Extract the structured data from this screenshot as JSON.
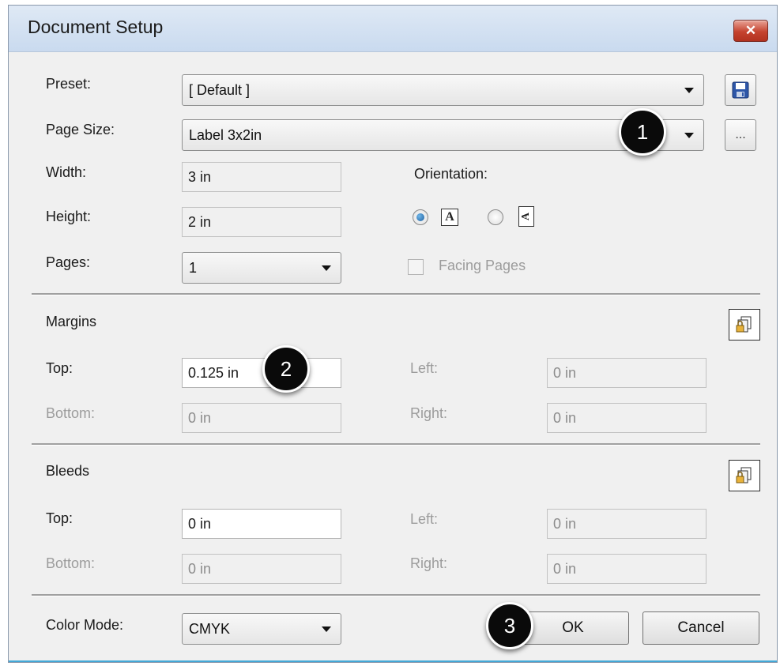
{
  "dialog": {
    "title": "Document Setup",
    "close_glyph": "✕"
  },
  "preset": {
    "label": "Preset:",
    "value": "[ Default ]"
  },
  "page_size": {
    "label": "Page Size:",
    "value": "Label 3x2in",
    "more_label": "..."
  },
  "width": {
    "label": "Width:",
    "value": "3 in"
  },
  "height": {
    "label": "Height:",
    "value": "2 in"
  },
  "pages": {
    "label": "Pages:",
    "value": "1"
  },
  "orientation": {
    "label": "Orientation:",
    "portrait_glyph": "A",
    "landscape_glyph": "A",
    "selected": "portrait"
  },
  "facing_pages": {
    "label": "Facing Pages",
    "checked": false
  },
  "margins": {
    "heading": "Margins",
    "top_label": "Top:",
    "top_value": "0.125 in",
    "bottom_label": "Bottom:",
    "bottom_value": "0 in",
    "left_label": "Left:",
    "left_value": "0 in",
    "right_label": "Right:",
    "right_value": "0 in"
  },
  "bleeds": {
    "heading": "Bleeds",
    "top_label": "Top:",
    "top_value": "0 in",
    "bottom_label": "Bottom:",
    "bottom_value": "0 in",
    "left_label": "Left:",
    "left_value": "0 in",
    "right_label": "Right:",
    "right_value": "0 in"
  },
  "color_mode": {
    "label": "Color Mode:",
    "value": "CMYK"
  },
  "buttons": {
    "ok": "OK",
    "cancel": "Cancel"
  },
  "markers": [
    "1",
    "2",
    "3"
  ],
  "icons": {
    "save": "save-icon",
    "link_margins": "link-icon",
    "link_bleeds": "link-icon"
  },
  "colors": {
    "accent": "#43a9d8",
    "close_red": "#c5432f",
    "marker_bg": "#0a0a0a"
  }
}
